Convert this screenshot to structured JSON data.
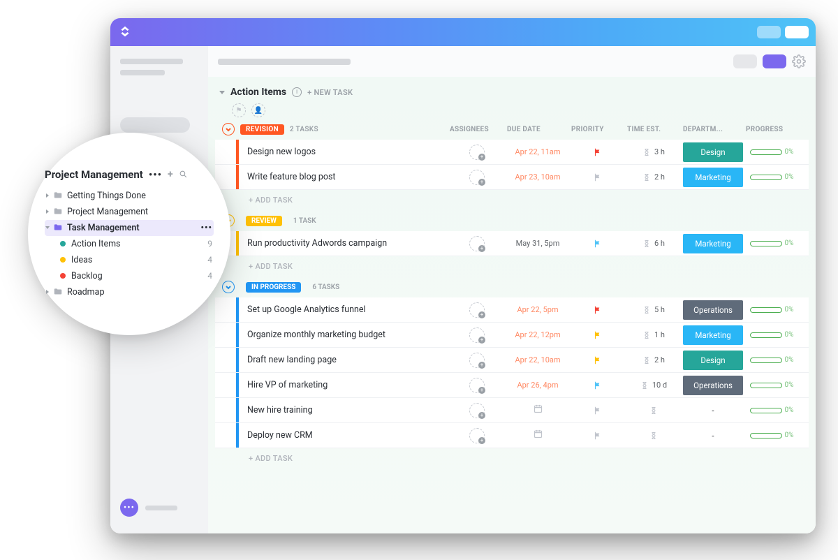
{
  "list": {
    "title": "Action Items",
    "newTask": "+ NEW TASK",
    "addTask": "+ ADD TASK"
  },
  "columns": {
    "assignees": "ASSIGNEES",
    "dueDate": "DUE DATE",
    "priority": "PRIORITY",
    "timeEst": "TIME EST.",
    "department": "DEPARTM...",
    "progress": "PROGRESS"
  },
  "statuses": {
    "revision": {
      "label": "REVISION",
      "count": "2 TASKS"
    },
    "review": {
      "label": "REVIEW",
      "count": "1 TASK"
    },
    "inProgress": {
      "label": "IN PROGRESS",
      "count": "6 TASKS"
    }
  },
  "tasks": {
    "revision": [
      {
        "name": "Design new logos",
        "due": "Apr 22, 11am",
        "dueColor": "orange",
        "flag": "red",
        "time": "3 h",
        "dept": "Design",
        "deptColor": "#26a69a",
        "progress": "0%"
      },
      {
        "name": "Write feature blog post",
        "due": "Apr 23, 10am",
        "dueColor": "orange",
        "flag": "gray",
        "time": "2 h",
        "dept": "Marketing",
        "deptColor": "#29b6f6",
        "progress": "0%"
      }
    ],
    "review": [
      {
        "name": "Run productivity Adwords campaign",
        "due": "May 31, 5pm",
        "dueColor": "gray",
        "flag": "cyan",
        "time": "6 h",
        "dept": "Marketing",
        "deptColor": "#29b6f6",
        "progress": "0%"
      }
    ],
    "inProgress": [
      {
        "name": "Set up Google Analytics funnel",
        "due": "Apr 22, 5pm",
        "dueColor": "orange",
        "flag": "red",
        "time": "5 h",
        "dept": "Operations",
        "deptColor": "#5f6b7a",
        "progress": "0%"
      },
      {
        "name": "Organize monthly marketing budget",
        "due": "Apr 22, 12pm",
        "dueColor": "orange",
        "flag": "yellow",
        "time": "1 h",
        "dept": "Marketing",
        "deptColor": "#29b6f6",
        "progress": "0%"
      },
      {
        "name": "Draft new landing page",
        "due": "Apr 22, 10am",
        "dueColor": "orange",
        "flag": "yellow",
        "time": "2 h",
        "dept": "Design",
        "deptColor": "#26a69a",
        "progress": "0%"
      },
      {
        "name": "Hire VP of marketing",
        "due": "Apr 26, 4pm",
        "dueColor": "orange",
        "flag": "cyan",
        "time": "10 d",
        "dept": "Operations",
        "deptColor": "#5f6b7a",
        "progress": "0%"
      },
      {
        "name": "New hire training",
        "due": "",
        "dueColor": "",
        "flag": "gray",
        "time": "",
        "dept": "-",
        "deptColor": "",
        "progress": "0%"
      },
      {
        "name": "Deploy new CRM",
        "due": "",
        "dueColor": "",
        "flag": "gray",
        "time": "",
        "dept": "-",
        "deptColor": "",
        "progress": "0%"
      }
    ]
  },
  "sidebar": {
    "title": "Project Management",
    "folders": [
      {
        "label": "Getting Things Done",
        "open": false
      },
      {
        "label": "Project Management",
        "open": false
      },
      {
        "label": "Task Management",
        "open": true,
        "selected": true
      }
    ],
    "lists": [
      {
        "label": "Action Items",
        "color": "#26a69a",
        "count": "9"
      },
      {
        "label": "Ideas",
        "color": "#ffc107",
        "count": "4"
      },
      {
        "label": "Backlog",
        "color": "#f44336",
        "count": "4"
      }
    ],
    "roadmap": "Roadmap"
  }
}
